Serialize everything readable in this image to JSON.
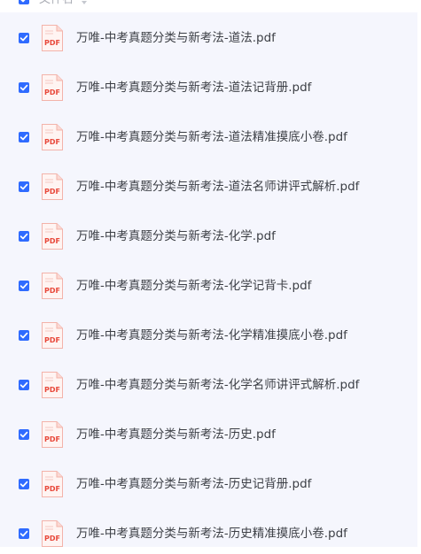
{
  "header": {
    "column_title": "文件名",
    "sort_icon": "sort-icon"
  },
  "accent_color": "#2f6bff",
  "files": [
    {
      "name": "万唯-中考真题分类与新考法-道法.pdf",
      "checked": true,
      "icon": "pdf-file-icon"
    },
    {
      "name": "万唯-中考真题分类与新考法-道法记背册.pdf",
      "checked": true,
      "icon": "pdf-file-icon"
    },
    {
      "name": "万唯-中考真题分类与新考法-道法精准摸底小卷.pdf",
      "checked": true,
      "icon": "pdf-file-icon"
    },
    {
      "name": "万唯-中考真题分类与新考法-道法名师讲评式解析.pdf",
      "checked": true,
      "icon": "pdf-file-icon"
    },
    {
      "name": "万唯-中考真题分类与新考法-化学.pdf",
      "checked": true,
      "icon": "pdf-file-icon"
    },
    {
      "name": "万唯-中考真题分类与新考法-化学记背卡.pdf",
      "checked": true,
      "icon": "pdf-file-icon"
    },
    {
      "name": "万唯-中考真题分类与新考法-化学精准摸底小卷.pdf",
      "checked": true,
      "icon": "pdf-file-icon"
    },
    {
      "name": "万唯-中考真题分类与新考法-化学名师讲评式解析.pdf",
      "checked": true,
      "icon": "pdf-file-icon"
    },
    {
      "name": "万唯-中考真题分类与新考法-历史.pdf",
      "checked": true,
      "icon": "pdf-file-icon"
    },
    {
      "name": "万唯-中考真题分类与新考法-历史记背册.pdf",
      "checked": true,
      "icon": "pdf-file-icon"
    },
    {
      "name": "万唯-中考真题分类与新考法-历史精准摸底小卷.pdf",
      "checked": true,
      "icon": "pdf-file-icon"
    }
  ],
  "icon_label": "PDF"
}
